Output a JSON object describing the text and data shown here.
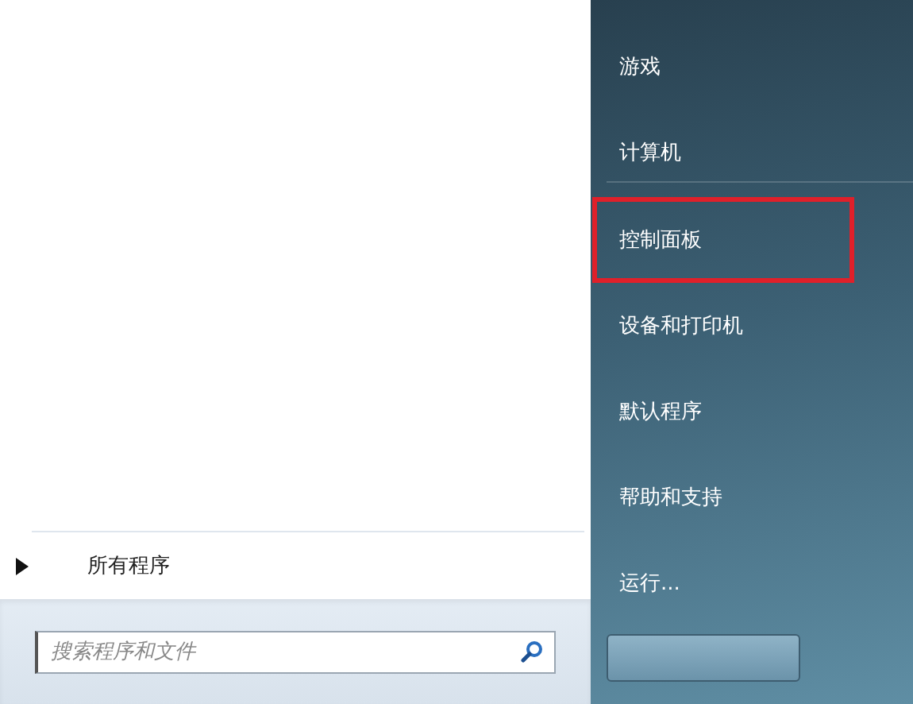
{
  "all_programs": {
    "label": "所有程序"
  },
  "search": {
    "placeholder": "搜索程序和文件"
  },
  "right_menu": [
    {
      "kind": "item",
      "label": "游戏",
      "highlighted": false
    },
    {
      "kind": "item",
      "label": "计算机",
      "highlighted": false
    },
    {
      "kind": "separator"
    },
    {
      "kind": "item",
      "label": "控制面板",
      "highlighted": true
    },
    {
      "kind": "item",
      "label": "设备和打印机",
      "highlighted": false
    },
    {
      "kind": "item",
      "label": "默认程序",
      "highlighted": false
    },
    {
      "kind": "item",
      "label": "帮助和支持",
      "highlighted": false
    },
    {
      "kind": "item",
      "label": "运行...",
      "highlighted": false
    }
  ]
}
